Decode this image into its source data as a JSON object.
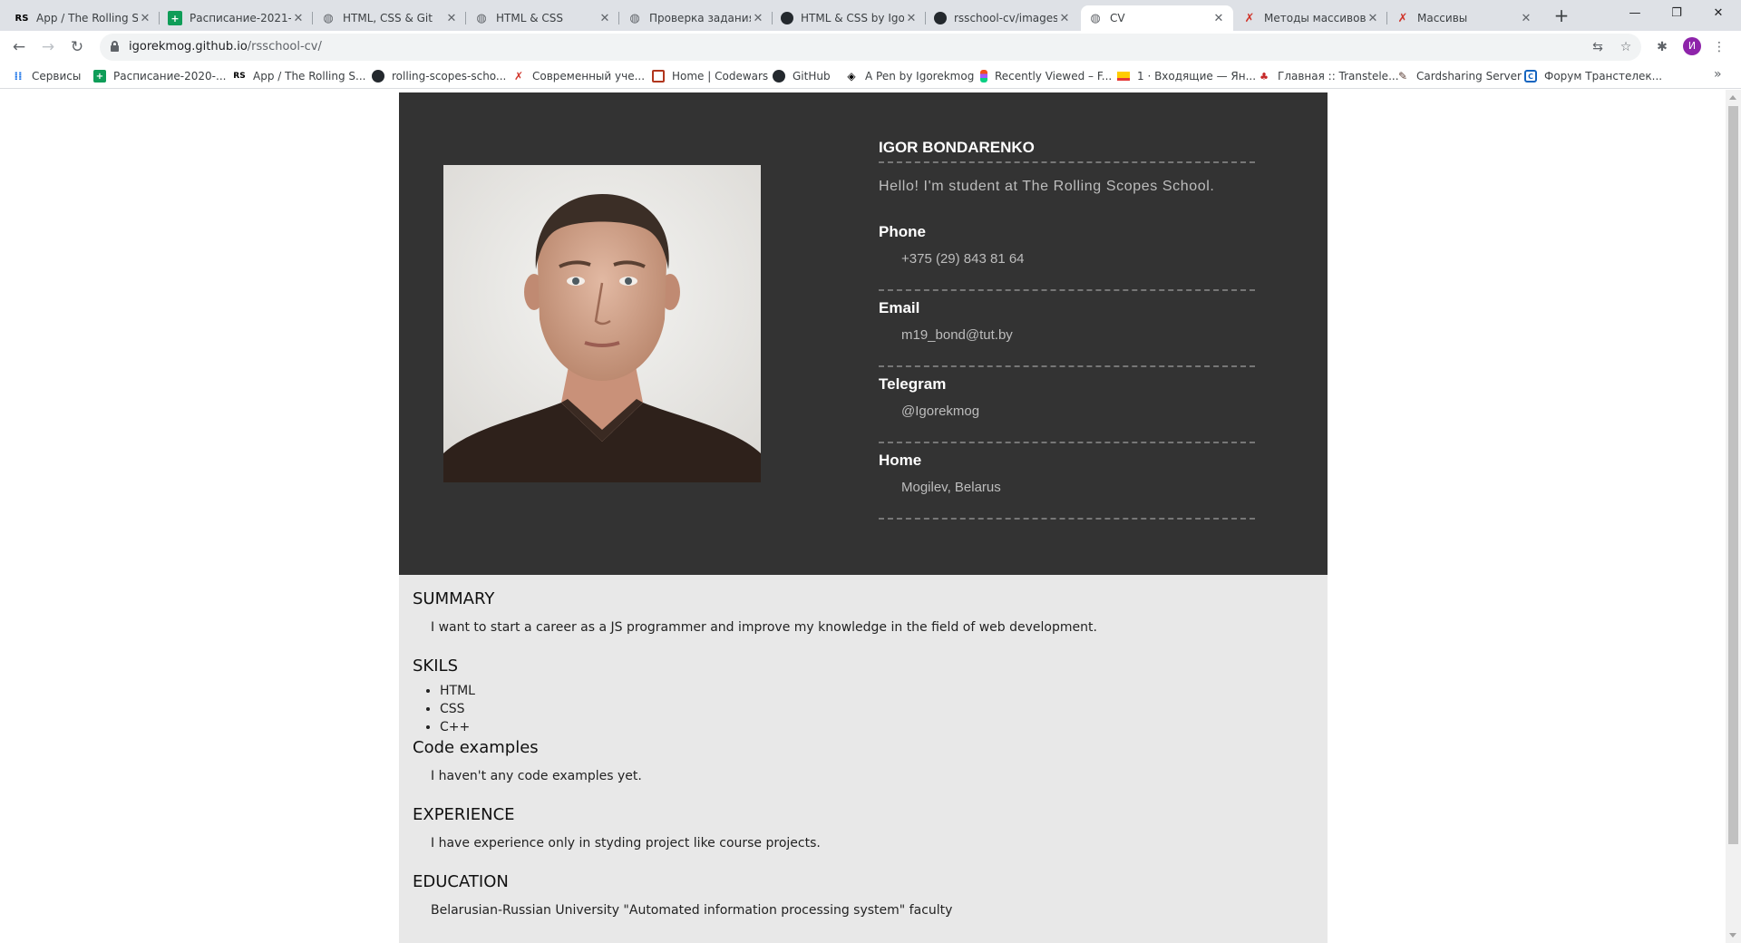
{
  "browser": {
    "tabs": [
      {
        "title": "App / The Rolling S",
        "icon": "rs-logo"
      },
      {
        "title": "Расписание-2021-",
        "icon": "sheets-icon"
      },
      {
        "title": "HTML, CSS & Git",
        "icon": "globe-icon"
      },
      {
        "title": "HTML & CSS",
        "icon": "globe-icon"
      },
      {
        "title": "Проверка задания",
        "icon": "globe-icon"
      },
      {
        "title": "HTML & CSS by Igo",
        "icon": "github-icon"
      },
      {
        "title": "rsschool-cv/images",
        "icon": "github-icon"
      },
      {
        "title": "CV",
        "icon": "globe-icon"
      },
      {
        "title": "Методы массивов",
        "icon": "learnjs-icon"
      },
      {
        "title": "Массивы",
        "icon": "learnjs-icon"
      }
    ],
    "active_tab": 7,
    "url_host": "igorekmog.github.io",
    "url_path": "/rsschool-cv/",
    "profile_initial": "И",
    "bookmarks": [
      {
        "label": "Сервисы",
        "icon": "apps-grid-icon"
      },
      {
        "label": "Расписание-2020-...",
        "icon": "sheets-icon"
      },
      {
        "label": "App / The Rolling S...",
        "icon": "rs-logo"
      },
      {
        "label": "rolling-scopes-scho...",
        "icon": "github-icon"
      },
      {
        "label": "Современный уче...",
        "icon": "learnjs-icon"
      },
      {
        "label": "Home | Codewars",
        "icon": "codewars-icon"
      },
      {
        "label": "GitHub",
        "icon": "github-icon"
      },
      {
        "label": "A Pen by Igorekmog",
        "icon": "codepen-icon"
      },
      {
        "label": "Recently Viewed – F...",
        "icon": "figma-icon"
      },
      {
        "label": "1 · Входящие — Ян...",
        "icon": "mail-icon"
      },
      {
        "label": "Главная :: Transtele...",
        "icon": "transtelecom-icon"
      },
      {
        "label": "Cardsharing Server",
        "icon": "cardsharing-icon"
      },
      {
        "label": "Форум Транстелек...",
        "icon": "forum-icon"
      }
    ]
  },
  "cv": {
    "name": "IGOR BONDARENKO",
    "hello": "Hello! I'm student at The Rolling Scopes School.",
    "contacts": [
      {
        "label": "Phone",
        "value": "+375 (29) 843 81 64"
      },
      {
        "label": "Email",
        "value": "m19_bond@tut.by"
      },
      {
        "label": "Telegram",
        "value": "@Igorekmog"
      },
      {
        "label": "Home",
        "value": "Mogilev, Belarus"
      }
    ],
    "summary_title": "SUMMARY",
    "summary_text": "I want to start a career as a JS programmer and improve my knowledge in the field of web development.",
    "skills_title": "SKILS",
    "skills": [
      "HTML",
      "CSS",
      "C++"
    ],
    "code_title": "Code examples",
    "code_text": "I haven't any code examples yet.",
    "experience_title": "EXPERIENCE",
    "experience_text": "I have experience only in styding project like course projects.",
    "education_title": "EDUCATION",
    "education_text": "Belarusian-Russian University \"Automated information processing system\" faculty"
  }
}
